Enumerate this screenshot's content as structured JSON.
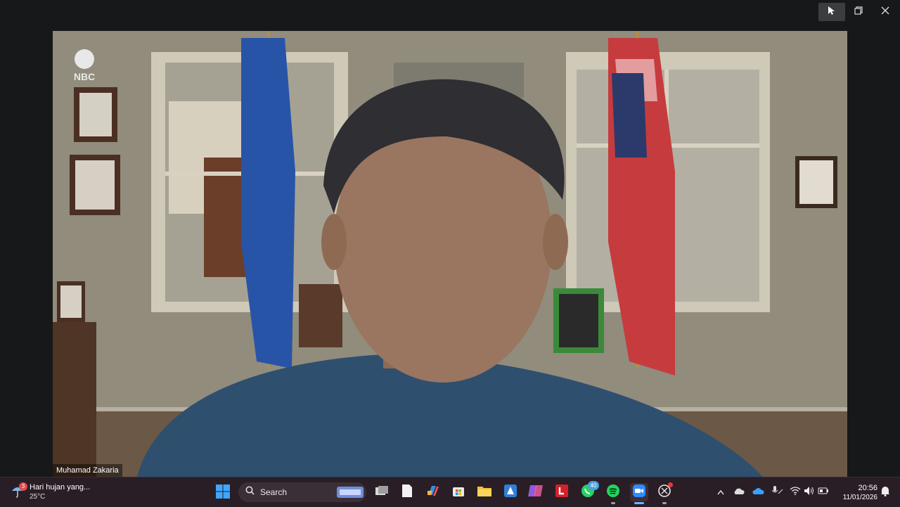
{
  "window": {
    "controls": {
      "pointer": "pointer-icon",
      "restore": "restore-icon",
      "close": "close-icon"
    }
  },
  "video": {
    "participant_name": "Muhamad Zakaria",
    "logo": "NBC",
    "background": "office-scene-with-flags"
  },
  "taskbar": {
    "weather": {
      "desc": "Hari hujan yang...",
      "temp": "25°C",
      "alert_count": "3"
    },
    "search_label": "Search",
    "apps": [
      {
        "name": "task-view"
      },
      {
        "name": "file-explorer"
      },
      {
        "name": "copilot"
      },
      {
        "name": "microsoft-store"
      },
      {
        "name": "folder"
      },
      {
        "name": "azure-data-studio"
      },
      {
        "name": "teams-premium"
      },
      {
        "name": "l-app"
      },
      {
        "name": "whatsapp",
        "badge": "40"
      },
      {
        "name": "spotify"
      },
      {
        "name": "zoom"
      },
      {
        "name": "snipping-tool"
      }
    ],
    "clock": {
      "time": "20:56",
      "date": "11/01/2026"
    }
  },
  "colors": {
    "titlebar": "#161819",
    "taskbar": "#2a1e26",
    "accent": "#6fb1ff"
  }
}
